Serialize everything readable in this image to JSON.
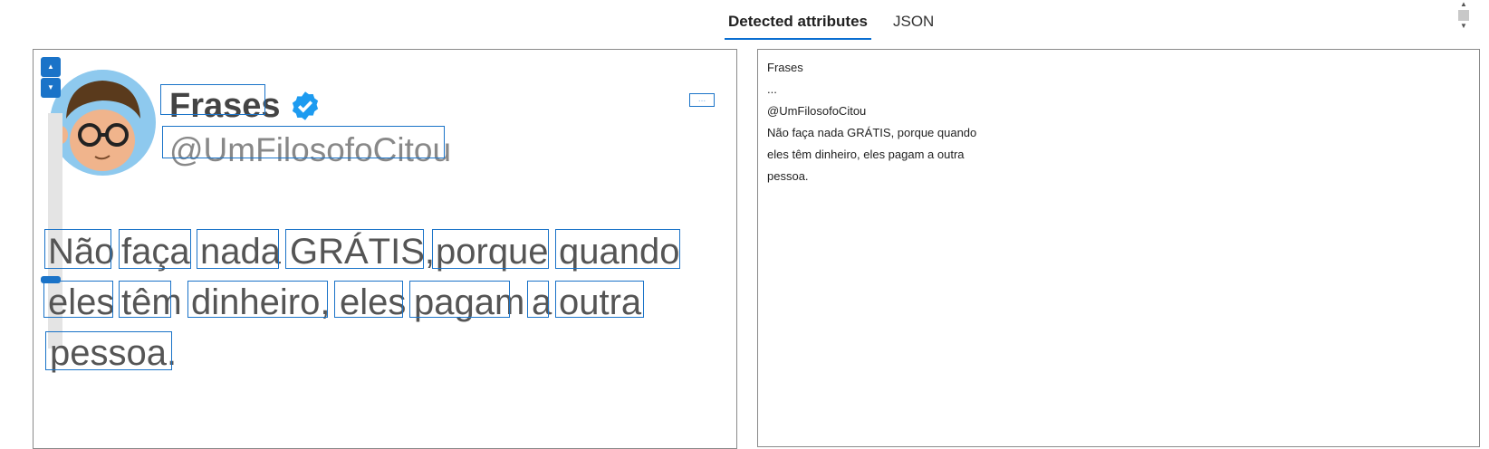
{
  "tabs": [
    {
      "label": "Detected attributes",
      "active": true
    },
    {
      "label": "JSON",
      "active": false
    }
  ],
  "tweet": {
    "name": "Frases",
    "handle": "@UmFilosofoCitou",
    "more_label": "...",
    "words": [
      "Não",
      "faça",
      "nada",
      "GRÁTIS,",
      "porque",
      "quando",
      "eles",
      "têm",
      "dinheiro,",
      "eles",
      "pagam",
      "a",
      "outra",
      "pessoa."
    ]
  },
  "attributes": {
    "lines": [
      "Frases",
      "...",
      "@UmFilosofoCitou",
      "Não faça nada GRÁTIS, porque quando",
      "eles têm dinheiro, eles pagam a outra",
      "pessoa."
    ]
  },
  "colors": {
    "accent": "#1a73c8",
    "verified": "#1d9bf0"
  }
}
